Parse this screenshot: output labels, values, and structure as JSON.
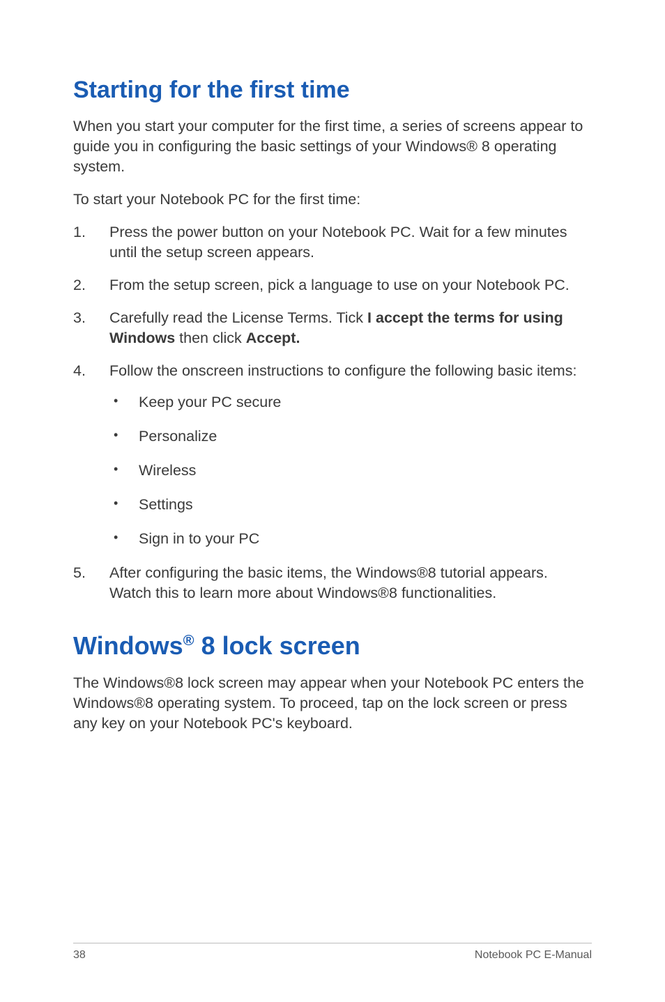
{
  "section1": {
    "heading": "Starting for the first time",
    "p1": "When you start your computer for the first time, a series of screens appear to guide you in configuring the basic settings of your Windows® 8 operating system.",
    "p2": "To start your Notebook PC for the first time:",
    "steps": {
      "s1": "Press the power button on your Notebook PC. Wait for a few minutes until the setup screen appears.",
      "s2": "From the setup screen, pick a language to use on your Notebook PC.",
      "s3_pre": "Carefully read the License Terms. Tick ",
      "s3_bold1": "I accept the terms for using Windows",
      "s3_mid": " then click ",
      "s3_bold2": "Accept.",
      "s4": "Follow the onscreen instructions to configure the following basic items:",
      "s4_items": {
        "b1": "Keep your PC secure",
        "b2": "Personalize",
        "b3": "Wireless",
        "b4": "Settings",
        "b5": "Sign in to your PC"
      },
      "s5": "After configuring the basic items, the Windows®8 tutorial appears. Watch this to learn more about Windows®8 functionalities."
    }
  },
  "section2": {
    "heading_pre": "Windows",
    "heading_reg": "®",
    "heading_post": " 8 lock screen",
    "p1": "The Windows®8 lock screen may appear when your Notebook PC enters the Windows®8 operating system. To proceed,  tap on the lock screen or press any key on your Notebook PC's keyboard."
  },
  "footer": {
    "page": "38",
    "title": "Notebook PC E-Manual"
  }
}
